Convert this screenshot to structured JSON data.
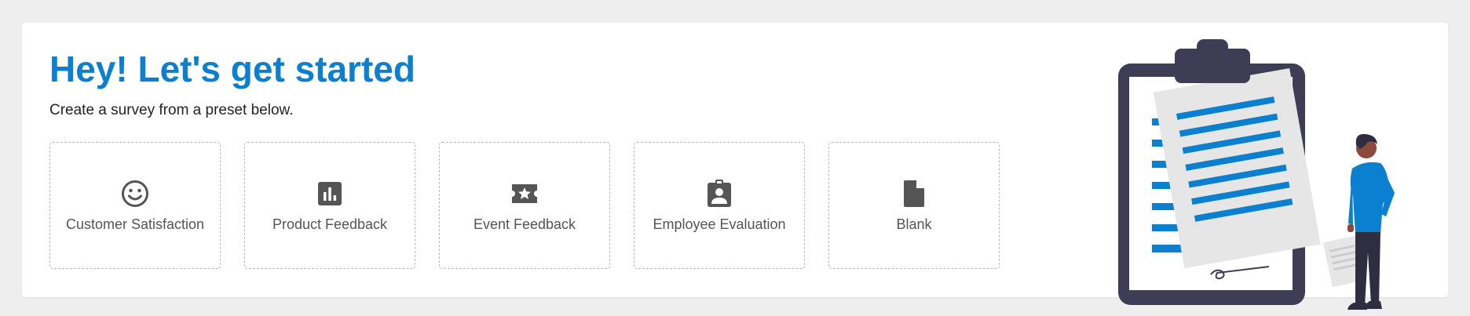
{
  "header": {
    "title": "Hey! Let's get started",
    "subtitle": "Create a survey from a preset below."
  },
  "presets": [
    {
      "label": "Customer Satisfaction",
      "icon": "smiley-face-icon"
    },
    {
      "label": "Product Feedback",
      "icon": "bar-chart-icon"
    },
    {
      "label": "Event Feedback",
      "icon": "ticket-star-icon"
    },
    {
      "label": "Employee Evaluation",
      "icon": "badge-person-icon"
    },
    {
      "label": "Blank",
      "icon": "blank-document-icon"
    }
  ],
  "colors": {
    "accent": "#0b7fd0",
    "page_background": "#eeeeee",
    "card_background": "#ffffff",
    "icon": "#555555",
    "clipboard_frame": "#3f3d56",
    "figure_shirt": "#0b7fd0"
  }
}
